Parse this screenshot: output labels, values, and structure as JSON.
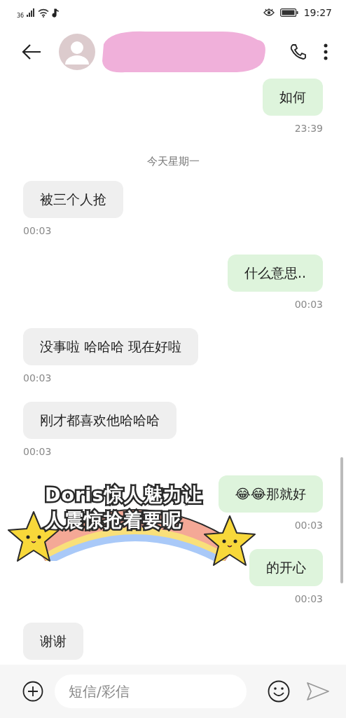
{
  "status_bar": {
    "network": "36",
    "time": "19:27"
  },
  "input": {
    "placeholder": "短信/彩信"
  },
  "messages": [
    {
      "kind": "outgoing",
      "text": "如何",
      "time": "23:39"
    },
    {
      "kind": "date",
      "text": "今天星期一"
    },
    {
      "kind": "incoming",
      "text": "被三个人抢",
      "time": "00:03"
    },
    {
      "kind": "outgoing",
      "text": "什么意思..",
      "time": "00:03"
    },
    {
      "kind": "incoming",
      "text": "没事啦 哈哈哈 现在好啦",
      "time": "00:03"
    },
    {
      "kind": "incoming",
      "text": "刚才都喜欢他哈哈哈",
      "time": "00:03"
    },
    {
      "kind": "outgoing",
      "text": "😂😂那就好",
      "time": "00:03"
    },
    {
      "kind": "outgoing",
      "text": "的开心",
      "time": "00:03"
    },
    {
      "kind": "incoming",
      "text": "谢谢"
    }
  ],
  "sticker": {
    "lines": [
      "Doris惊人魅力让",
      "人震惊抢着要呢"
    ]
  }
}
